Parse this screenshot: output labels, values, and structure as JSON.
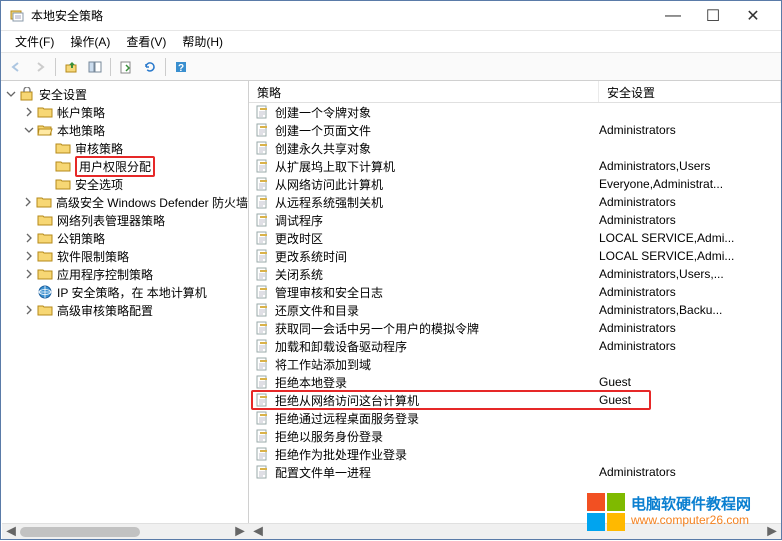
{
  "window": {
    "title": "本地安全策略",
    "min": "—",
    "max": "☐",
    "close": "✕"
  },
  "menu": {
    "file": "文件(F)",
    "action": "操作(A)",
    "view": "查看(V)",
    "help": "帮助(H)"
  },
  "tree_root": "安全设置",
  "tree": [
    {
      "label": "帐户策略",
      "expanded": false,
      "level": 1,
      "icon": "folder"
    },
    {
      "label": "本地策略",
      "expanded": true,
      "level": 1,
      "icon": "folder-open",
      "children": [
        {
          "label": "审核策略",
          "level": 2,
          "icon": "folder"
        },
        {
          "label": "用户权限分配",
          "level": 2,
          "icon": "folder",
          "highlighted": true
        },
        {
          "label": "安全选项",
          "level": 2,
          "icon": "folder"
        }
      ]
    },
    {
      "label": "高级安全 Windows Defender 防火墙",
      "expanded": false,
      "level": 1,
      "icon": "folder"
    },
    {
      "label": "网络列表管理器策略",
      "level": 1,
      "icon": "folder",
      "noexpand": true
    },
    {
      "label": "公钥策略",
      "expanded": false,
      "level": 1,
      "icon": "folder"
    },
    {
      "label": "软件限制策略",
      "expanded": false,
      "level": 1,
      "icon": "folder"
    },
    {
      "label": "应用程序控制策略",
      "expanded": false,
      "level": 1,
      "icon": "folder"
    },
    {
      "label": "IP 安全策略，在 本地计算机",
      "level": 1,
      "icon": "ipsec",
      "noexpand": true
    },
    {
      "label": "高级审核策略配置",
      "expanded": false,
      "level": 1,
      "icon": "folder"
    }
  ],
  "columns": {
    "policy": "策略",
    "setting": "安全设置"
  },
  "policies": [
    {
      "name": "创建一个令牌对象",
      "setting": ""
    },
    {
      "name": "创建一个页面文件",
      "setting": "Administrators"
    },
    {
      "name": "创建永久共享对象",
      "setting": ""
    },
    {
      "name": "从扩展坞上取下计算机",
      "setting": "Administrators,Users"
    },
    {
      "name": "从网络访问此计算机",
      "setting": "Everyone,Administrat..."
    },
    {
      "name": "从远程系统强制关机",
      "setting": "Administrators"
    },
    {
      "name": "调试程序",
      "setting": "Administrators"
    },
    {
      "name": "更改时区",
      "setting": "LOCAL SERVICE,Admi..."
    },
    {
      "name": "更改系统时间",
      "setting": "LOCAL SERVICE,Admi..."
    },
    {
      "name": "关闭系统",
      "setting": "Administrators,Users,..."
    },
    {
      "name": "管理审核和安全日志",
      "setting": "Administrators"
    },
    {
      "name": "还原文件和目录",
      "setting": "Administrators,Backu..."
    },
    {
      "name": "获取同一会话中另一个用户的模拟令牌",
      "setting": "Administrators"
    },
    {
      "name": "加载和卸载设备驱动程序",
      "setting": "Administrators"
    },
    {
      "name": "将工作站添加到域",
      "setting": ""
    },
    {
      "name": "拒绝本地登录",
      "setting": "Guest"
    },
    {
      "name": "拒绝从网络访问这台计算机",
      "setting": "Guest",
      "highlighted": true
    },
    {
      "name": "拒绝通过远程桌面服务登录",
      "setting": ""
    },
    {
      "name": "拒绝以服务身份登录",
      "setting": ""
    },
    {
      "name": "拒绝作为批处理作业登录",
      "setting": ""
    },
    {
      "name": "配置文件单一进程",
      "setting": "Administrators"
    }
  ],
  "watermark": {
    "title": "电脑软硬件教程网",
    "url": "www.computer26.com"
  }
}
